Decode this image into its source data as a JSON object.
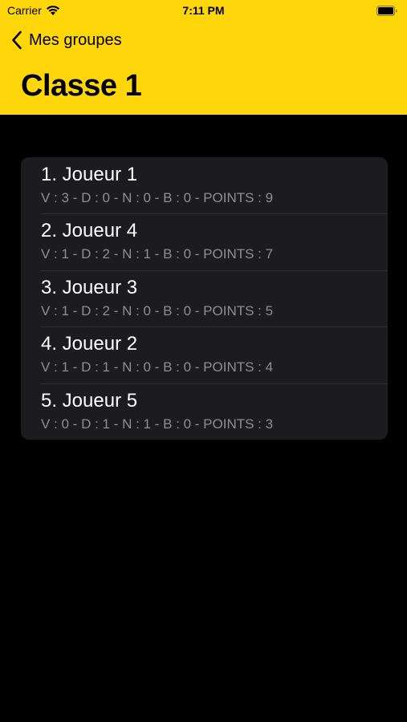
{
  "status_bar": {
    "carrier": "Carrier",
    "time": "7:11 PM"
  },
  "nav": {
    "back_label": "Mes groupes",
    "title": "Classe 1"
  },
  "colors": {
    "header_bg": "#FFD60A",
    "list_bg": "#1C1C1E",
    "secondary_text": "#8E8E93"
  },
  "ranking": [
    {
      "title": "1. Joueur 1",
      "stats": "V : 3 - D : 0 - N : 0 - B : 0 - POINTS : 9"
    },
    {
      "title": "2. Joueur 4",
      "stats": "V : 1 - D : 2 - N : 1 - B : 0 - POINTS : 7"
    },
    {
      "title": "3. Joueur 3",
      "stats": "V : 1 - D : 2 - N : 0 - B : 0 - POINTS : 5"
    },
    {
      "title": "4. Joueur 2",
      "stats": "V : 1 - D : 1 - N : 0 - B : 0 - POINTS : 4"
    },
    {
      "title": "5. Joueur 5",
      "stats": "V : 0 - D : 1 - N : 1 - B : 0 - POINTS : 3"
    }
  ]
}
